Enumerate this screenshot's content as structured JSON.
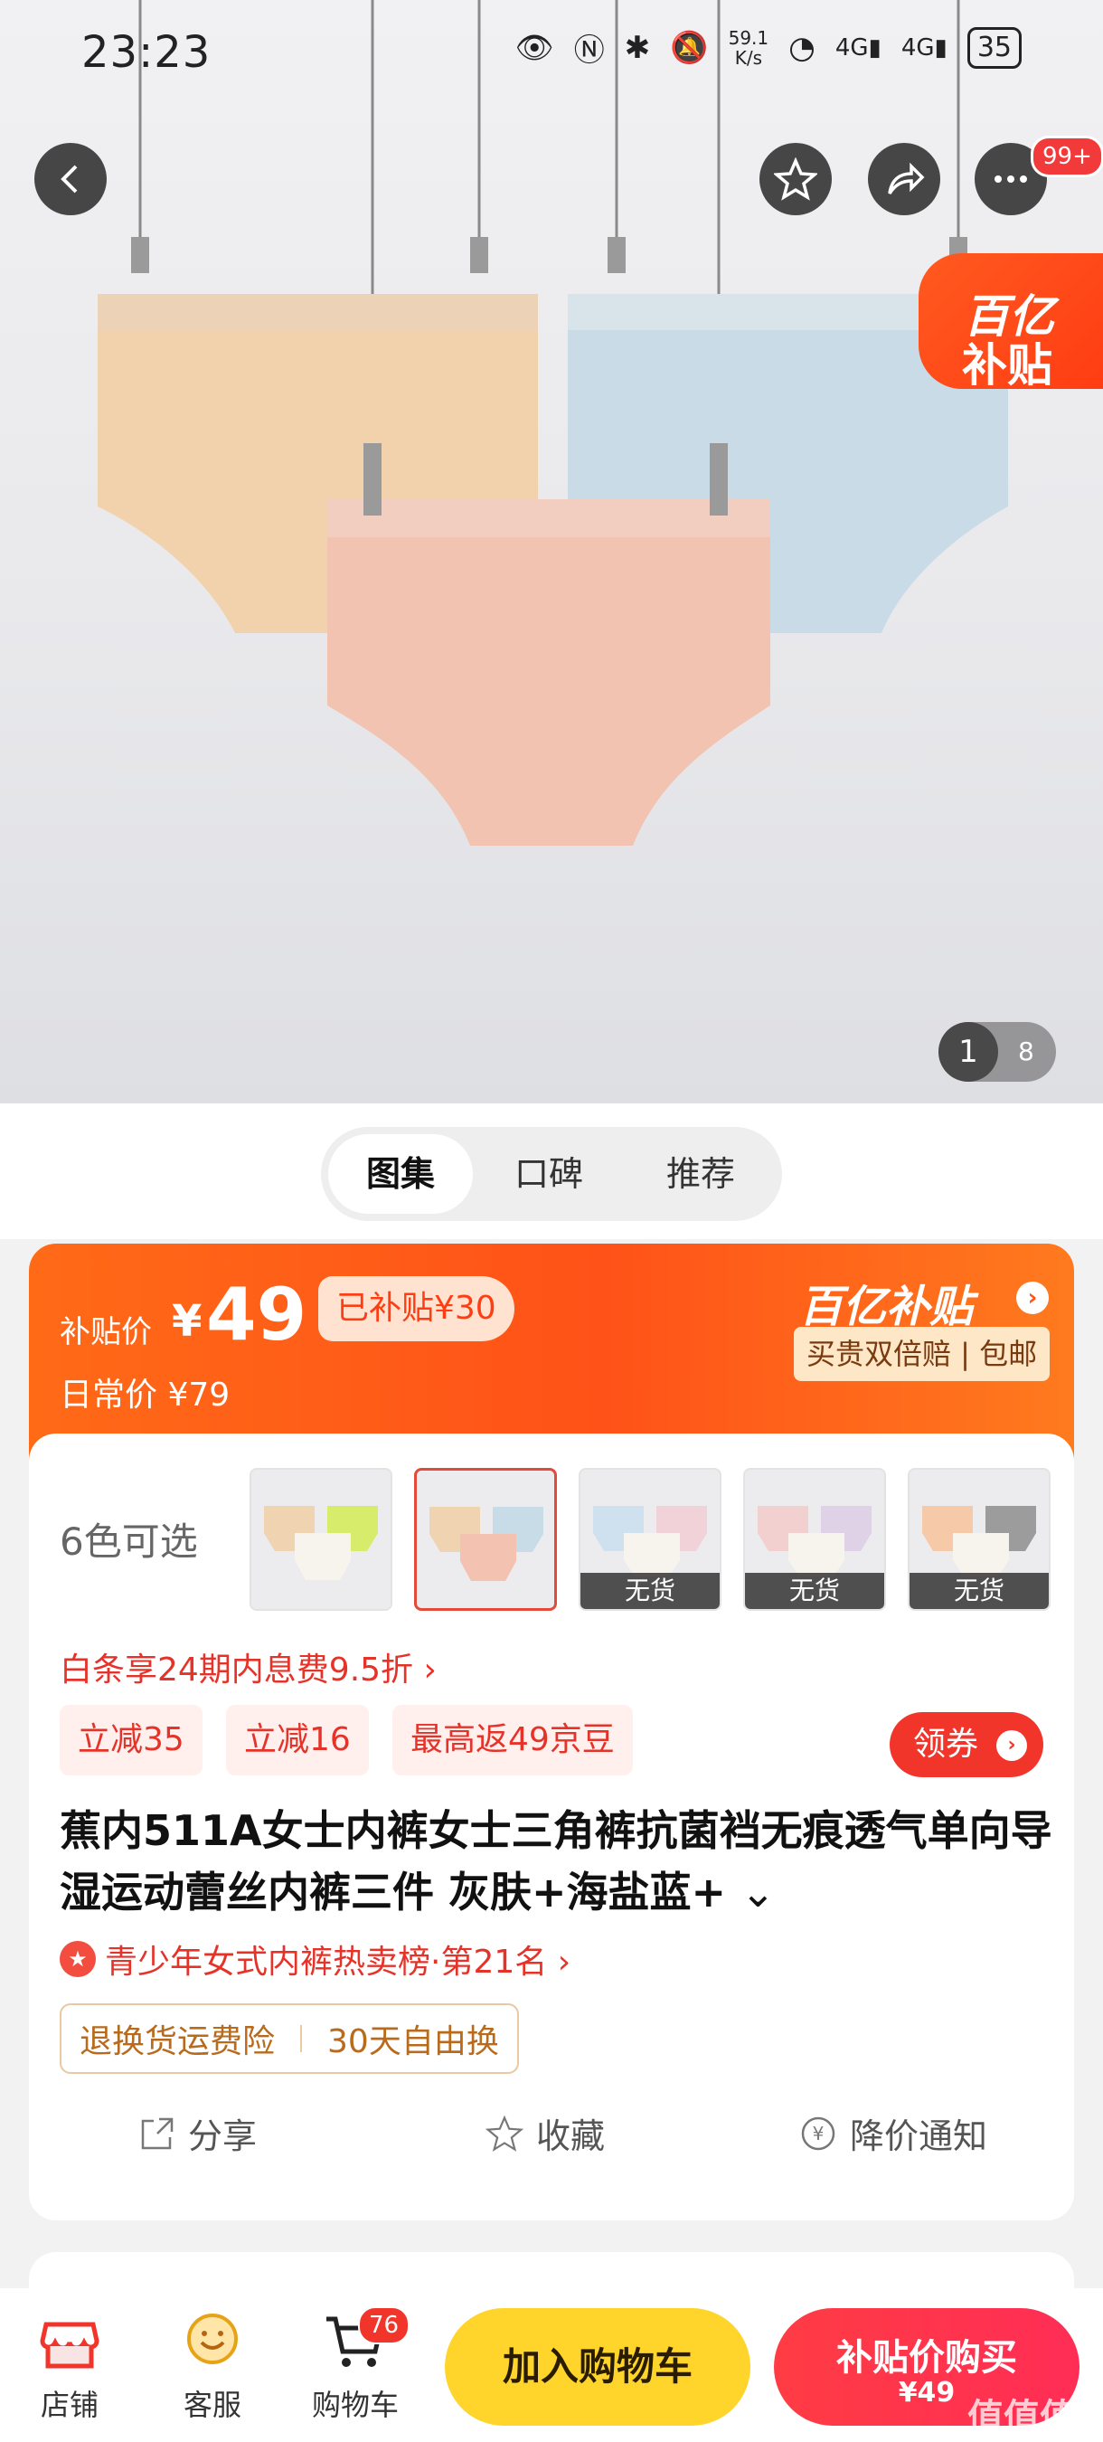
{
  "status_bar": {
    "time": "23:23",
    "net_speed_value": "59.1",
    "net_speed_unit": "K/s",
    "battery": "35"
  },
  "top_nav": {
    "more_badge": "99+",
    "subsidy_tag_line1": "百亿",
    "subsidy_tag_line2": "补贴"
  },
  "gallery": {
    "current": "1",
    "total": "8"
  },
  "tabs": [
    {
      "label": "图集",
      "active": true
    },
    {
      "label": "口碑",
      "active": false
    },
    {
      "label": "推荐",
      "active": false
    }
  ],
  "price": {
    "label": "补贴价",
    "currency": "¥",
    "value": "49",
    "subsidized": "已补贴¥30",
    "daily": "日常价 ¥79",
    "brand": "百亿补贴",
    "brand_sub": "买贵双倍赔 | 包邮"
  },
  "colors": {
    "label": "6色可选",
    "thumbs": [
      {
        "stock": ""
      },
      {
        "stock": ""
      },
      {
        "stock": "无货"
      },
      {
        "stock": "无货"
      },
      {
        "stock": "无货"
      }
    ]
  },
  "installment": "白条享24期内息费9.5折 ›",
  "promos": [
    "立减35",
    "立减16",
    "最高返49京豆"
  ],
  "coupon": "领券",
  "product_title": "蕉内511A女士内裤女士三角裤抗菌裆无痕透气单向导湿运动蕾丝内裤三件 灰肤+海盐蓝+",
  "ranking": "青少年女式内裤热卖榜·第21名 ›",
  "services": [
    "退换货运费险",
    "30天自由换"
  ],
  "actions": [
    "分享",
    "收藏",
    "降价通知"
  ],
  "bottom_bar": {
    "store": "店铺",
    "service": "客服",
    "cart": "购物车",
    "cart_count": "76",
    "add_to_cart": "加入购物车",
    "buy_label": "补贴价购买",
    "buy_price": "¥49"
  },
  "watermark": "值值值"
}
